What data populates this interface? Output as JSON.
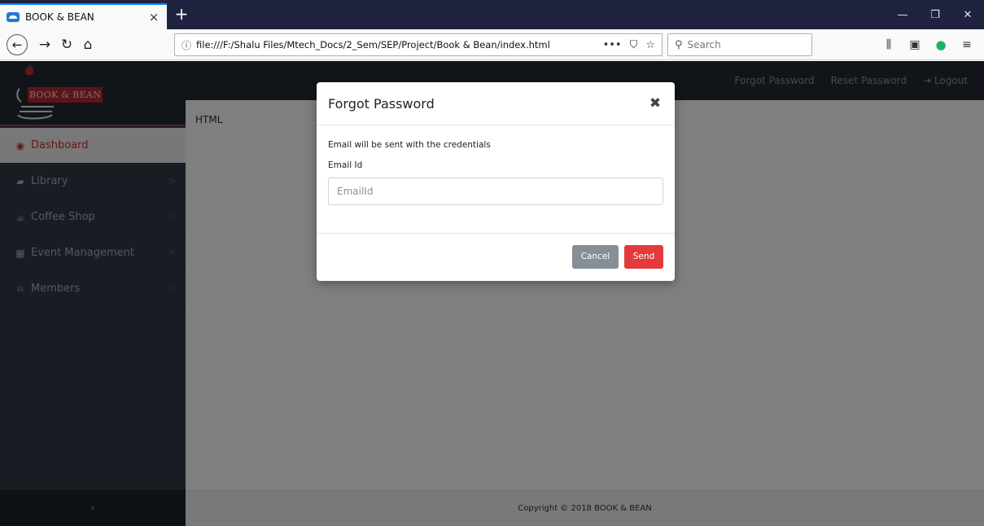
{
  "browser": {
    "tab_title": "BOOK & BEAN",
    "tab_close": "×",
    "new_tab": "+",
    "url_info": "ⓘ",
    "url": "file:///F:/Shalu Files/Mtech_Docs/2_Sem/SEP/Project/Book & Bean/index.html",
    "page_actions": "•••",
    "pocket_icon": "⛉",
    "star_icon": "☆",
    "search_placeholder": "Search",
    "back": "←",
    "forward": "→",
    "reload": "↻",
    "home": "⌂",
    "library_icon": "⫼",
    "sidebar_icon": "▣",
    "grammarly_icon": "●",
    "menu_icon": "≡",
    "minimize": "—",
    "restore": "❐",
    "close": "✕"
  },
  "app": {
    "logo_text": "BOOK & BEAN",
    "top_links": [
      "Forgot Password",
      "Reset Password",
      "Logout"
    ],
    "logout_icon": "⇥",
    "menu": [
      {
        "label": "Dashboard",
        "icon": "◉",
        "chev": ""
      },
      {
        "label": "Library",
        "icon": "▰",
        "chev": ">"
      },
      {
        "label": "Coffee Shop",
        "icon": "☕",
        "chev": ">"
      },
      {
        "label": "Event Management",
        "icon": "▦",
        "chev": ">"
      },
      {
        "label": "Members",
        "icon": "⍝",
        "chev": ">"
      }
    ],
    "sidebar_toggle": "‹",
    "content_text": "HTML",
    "footer": "Copyright © 2018 BOOK & BEAN"
  },
  "modal": {
    "title": "Forgot Password",
    "close": "✖",
    "message": "Email will be sent with the credentials",
    "email_label": "Email Id",
    "email_placeholder": "EmailId",
    "email_value": "",
    "cancel": "Cancel",
    "send": "Send"
  },
  "colors": {
    "accent_red": "#c0303a",
    "sidebar": "#2f3b46",
    "topbar": "#222b33",
    "send": "#e33b3b",
    "cancel": "#868e96"
  }
}
